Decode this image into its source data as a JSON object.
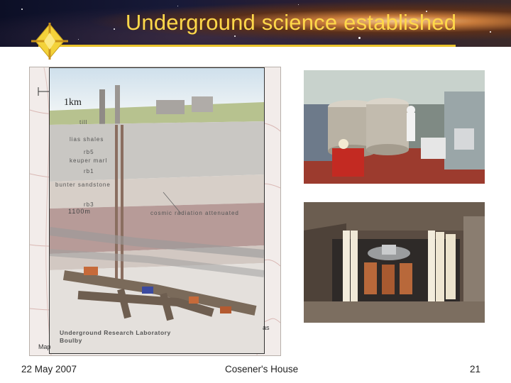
{
  "slide": {
    "title": "Underground science established",
    "date": "22 May 2007",
    "venue": "Cosener's House",
    "page_number": "21"
  },
  "figure_left": {
    "scale_label": "1km",
    "strata": [
      "till",
      "lias shales",
      "rb5",
      "keuper marl",
      "rb1",
      "bunter sandstone",
      "rb3"
    ],
    "depth_label": "1100m",
    "annotation": "cosmic radiation attenuated",
    "lab_title_line1": "Underground Research Laboratory",
    "lab_title_line2": "Boulby",
    "map_caption_fragment": "Map",
    "edge_fragment": "as"
  },
  "colors": {
    "title": "#ffd84a",
    "rule": "#e9c22a",
    "footer_text": "#222222"
  },
  "icons": [
    "star-logo-icon"
  ]
}
